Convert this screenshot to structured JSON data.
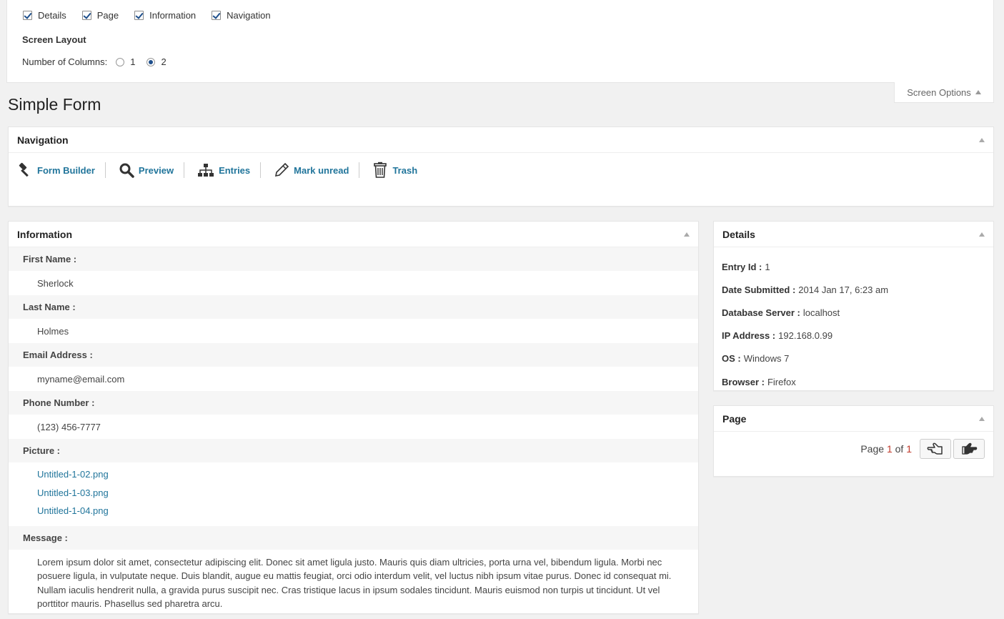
{
  "screen_options": {
    "checkboxes": [
      {
        "label": "Details",
        "checked": true
      },
      {
        "label": "Page",
        "checked": true
      },
      {
        "label": "Information",
        "checked": true
      },
      {
        "label": "Navigation",
        "checked": true
      }
    ],
    "layout_heading": "Screen Layout",
    "columns_label": "Number of Columns:",
    "column_options": [
      "1",
      "2"
    ],
    "selected_columns": "2",
    "tab_label": "Screen Options"
  },
  "page_title": "Simple Form",
  "navigation": {
    "title": "Navigation",
    "links": [
      {
        "label": "Form Builder",
        "icon": "gavel-icon"
      },
      {
        "label": "Preview",
        "icon": "search-icon"
      },
      {
        "label": "Entries",
        "icon": "sitemap-icon"
      },
      {
        "label": "Mark unread",
        "icon": "pencil-icon"
      },
      {
        "label": "Trash",
        "icon": "trash-icon"
      }
    ]
  },
  "information": {
    "title": "Information",
    "first_name_label": "First Name :",
    "first_name": "Sherlock",
    "last_name_label": "Last Name :",
    "last_name": "Holmes",
    "email_label": "Email Address :",
    "email": "myname@email.com",
    "phone_label": "Phone Number :",
    "phone": "(123) 456-7777",
    "picture_label": "Picture :",
    "pictures": [
      "Untitled-1-02.png",
      "Untitled-1-03.png",
      "Untitled-1-04.png"
    ],
    "message_label": "Message :",
    "message": "Lorem ipsum dolor sit amet, consectetur adipiscing elit. Donec sit amet ligula justo. Mauris quis diam ultricies, porta urna vel, bibendum ligula. Morbi nec posuere ligula, in vulputate neque. Duis blandit, augue eu mattis feugiat, orci odio interdum velit, vel luctus nibh ipsum vitae purus. Donec id consequat mi. Nullam iaculis hendrerit nulla, a gravida purus suscipit nec. Cras tristique lacus in ipsum sodales tincidunt. Mauris euismod non turpis ut tincidunt. Ut vel porttitor mauris. Phasellus sed pharetra arcu."
  },
  "details": {
    "title": "Details",
    "rows": [
      {
        "label": "Entry Id :",
        "value": "1"
      },
      {
        "label": "Date Submitted :",
        "value": "2014 Jan 17, 6:23 am"
      },
      {
        "label": "Database Server :",
        "value": "localhost"
      },
      {
        "label": "IP Address :",
        "value": "192.168.0.99"
      },
      {
        "label": "OS :",
        "value": "Windows 7"
      },
      {
        "label": "Browser :",
        "value": "Firefox"
      }
    ]
  },
  "page_box": {
    "title": "Page",
    "page_word": "Page",
    "current": "1",
    "of_word": "of",
    "total": "1",
    "accent": "#c0392b"
  }
}
